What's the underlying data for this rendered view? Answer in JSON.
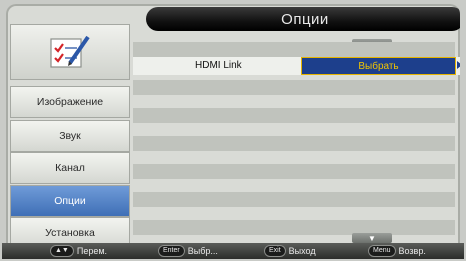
{
  "header": {
    "title": "Опции"
  },
  "sidebar": {
    "icon": "checklist-pencil-icon",
    "items": [
      {
        "label": "Изображение"
      },
      {
        "label": "Звук"
      },
      {
        "label": "Канал"
      },
      {
        "label": "Опции",
        "active": true
      },
      {
        "label": "Установка"
      }
    ]
  },
  "content": {
    "setting": {
      "label": "HDMI Link",
      "value": "Выбрать"
    }
  },
  "footer": {
    "hints": [
      {
        "key": "▲▼",
        "label": "Перем."
      },
      {
        "key": "Enter",
        "label": "Выбр..."
      },
      {
        "key": "Exit",
        "label": "Выход"
      },
      {
        "key": "Menu",
        "label": "Возвр."
      }
    ]
  },
  "colors": {
    "accent": "#3f6fb6",
    "value_bg": "#1d3f8c",
    "value_text": "#f2c500"
  }
}
